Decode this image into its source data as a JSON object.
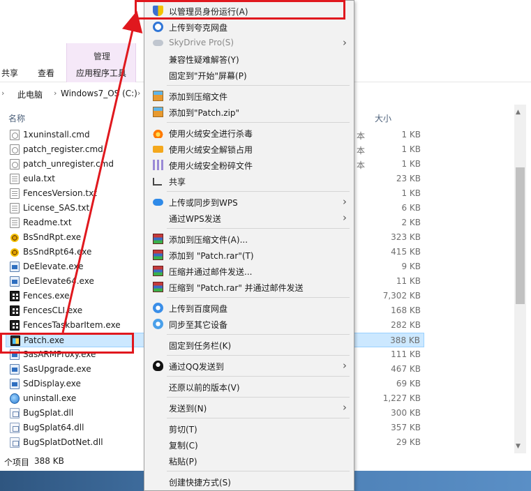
{
  "ribbon": {
    "context_group": "管理",
    "tabs": [
      "共享",
      "查看",
      "应用程序工具"
    ]
  },
  "address": {
    "crumbs": [
      "此电脑",
      "Windows7_OS (C:)"
    ]
  },
  "columns": {
    "name": "名称",
    "size": "大小"
  },
  "files": [
    {
      "name": "1xuninstall.cmd",
      "size": "1 KB",
      "type_frag": "本",
      "icon": "cmd"
    },
    {
      "name": "patch_register.cmd",
      "size": "1 KB",
      "type_frag": "本",
      "icon": "cmd"
    },
    {
      "name": "patch_unregister.cmd",
      "size": "1 KB",
      "type_frag": "本",
      "icon": "cmd"
    },
    {
      "name": "eula.txt",
      "size": "23 KB",
      "type_frag": "",
      "icon": "txt"
    },
    {
      "name": "FencesVersion.txt",
      "size": "1 KB",
      "type_frag": "",
      "icon": "txt"
    },
    {
      "name": "License_SAS.txt",
      "size": "6 KB",
      "type_frag": "",
      "icon": "txt"
    },
    {
      "name": "Readme.txt",
      "size": "2 KB",
      "type_frag": "",
      "icon": "txt"
    },
    {
      "name": "BsSndRpt.exe",
      "size": "323 KB",
      "type_frag": "",
      "icon": "exe-bug"
    },
    {
      "name": "BsSndRpt64.exe",
      "size": "415 KB",
      "type_frag": "",
      "icon": "exe-bug"
    },
    {
      "name": "DeElevate.exe",
      "size": "9 KB",
      "type_frag": "",
      "icon": "exe-blue"
    },
    {
      "name": "DeElevate64.exe",
      "size": "11 KB",
      "type_frag": "",
      "icon": "exe-blue"
    },
    {
      "name": "Fences.exe",
      "size": "7,302 KB",
      "type_frag": "",
      "icon": "exe-dark"
    },
    {
      "name": "FencesCLI.exe",
      "size": "168 KB",
      "type_frag": "",
      "icon": "exe-dark"
    },
    {
      "name": "FencesTaskbarItem.exe",
      "size": "282 KB",
      "type_frag": "",
      "icon": "exe-dark"
    },
    {
      "name": "Patch.exe",
      "size": "388 KB",
      "type_frag": "",
      "icon": "exe-patch",
      "selected": true
    },
    {
      "name": "SasARMProxy.exe",
      "size": "111 KB",
      "type_frag": "",
      "icon": "exe-blue"
    },
    {
      "name": "SasUpgrade.exe",
      "size": "467 KB",
      "type_frag": "",
      "icon": "exe-blue"
    },
    {
      "name": "SdDisplay.exe",
      "size": "69 KB",
      "type_frag": "",
      "icon": "exe-blue"
    },
    {
      "name": "uninstall.exe",
      "size": "1,227 KB",
      "type_frag": "",
      "icon": "exe-globe"
    },
    {
      "name": "BugSplat.dll",
      "size": "300 KB",
      "type_frag": "",
      "icon": "dll"
    },
    {
      "name": "BugSplat64.dll",
      "size": "357 KB",
      "type_frag": "",
      "icon": "dll"
    },
    {
      "name": "BugSplatDotNet.dll",
      "size": "29 KB",
      "type_frag": "",
      "icon": "dll"
    }
  ],
  "status": {
    "count": "个项目",
    "size": "388 KB"
  },
  "context_menu": {
    "items": [
      {
        "label": "以管理员身份运行(A)",
        "icon": "shield-icon",
        "cls": "ic-shield"
      },
      {
        "label": "上传到夸克网盘",
        "icon": "quark-icon",
        "cls": "ic-circle-blue"
      },
      {
        "label": "SkyDrive Pro(S)",
        "icon": "skydrive-icon",
        "cls": "ic-cloud-grey",
        "submenu": true,
        "disabled": true
      },
      {
        "label": "兼容性疑难解答(Y)",
        "icon": "",
        "cls": ""
      },
      {
        "label": "固定到\"开始\"屏幕(P)",
        "icon": "",
        "cls": ""
      },
      {
        "sep": true
      },
      {
        "label": "添加到压缩文件",
        "icon": "archive-icon",
        "cls": "ic-archive"
      },
      {
        "label": "添加到\"Patch.zip\"",
        "icon": "archive-icon",
        "cls": "ic-archive"
      },
      {
        "sep": true
      },
      {
        "label": "使用火绒安全进行杀毒",
        "icon": "flame-icon",
        "cls": "ic-flame"
      },
      {
        "label": "使用火绒安全解锁占用",
        "icon": "unlock-icon",
        "cls": "ic-lock"
      },
      {
        "label": "使用火绒安全粉碎文件",
        "icon": "shred-icon",
        "cls": "ic-shred"
      },
      {
        "label": "共享",
        "icon": "share-icon",
        "cls": "ic-share"
      },
      {
        "sep": true
      },
      {
        "label": "上传或同步到WPS",
        "icon": "wps-cloud-icon",
        "cls": "ic-cloud-blue",
        "submenu": true
      },
      {
        "label": "通过WPS发送",
        "icon": "",
        "cls": "",
        "submenu": true
      },
      {
        "sep": true
      },
      {
        "label": "添加到压缩文件(A)...",
        "icon": "winrar-icon",
        "cls": "ic-winrar"
      },
      {
        "label": "添加到 \"Patch.rar\"(T)",
        "icon": "winrar-icon",
        "cls": "ic-winrar"
      },
      {
        "label": "压缩并通过邮件发送...",
        "icon": "winrar-icon",
        "cls": "ic-winrar"
      },
      {
        "label": "压缩到 \"Patch.rar\" 并通过邮件发送",
        "icon": "winrar-icon",
        "cls": "ic-winrar"
      },
      {
        "sep": true
      },
      {
        "label": "上传到百度网盘",
        "icon": "baidu-cloud-icon",
        "cls": "ic-baidu"
      },
      {
        "label": "同步至其它设备",
        "icon": "sync-icon",
        "cls": "ic-sync"
      },
      {
        "sep": true
      },
      {
        "label": "固定到任务栏(K)",
        "icon": "",
        "cls": ""
      },
      {
        "sep": true
      },
      {
        "label": "通过QQ发送到",
        "icon": "qq-icon",
        "cls": "ic-qq",
        "submenu": true
      },
      {
        "sep": true
      },
      {
        "label": "还原以前的版本(V)",
        "icon": "",
        "cls": ""
      },
      {
        "sep": true
      },
      {
        "label": "发送到(N)",
        "icon": "",
        "cls": "",
        "submenu": true
      },
      {
        "sep": true
      },
      {
        "label": "剪切(T)",
        "icon": "",
        "cls": ""
      },
      {
        "label": "复制(C)",
        "icon": "",
        "cls": ""
      },
      {
        "label": "粘贴(P)",
        "icon": "",
        "cls": ""
      },
      {
        "sep": true
      },
      {
        "label": "创建快捷方式(S)",
        "icon": "",
        "cls": ""
      }
    ]
  },
  "annotation": {
    "color": "#e0181e"
  }
}
